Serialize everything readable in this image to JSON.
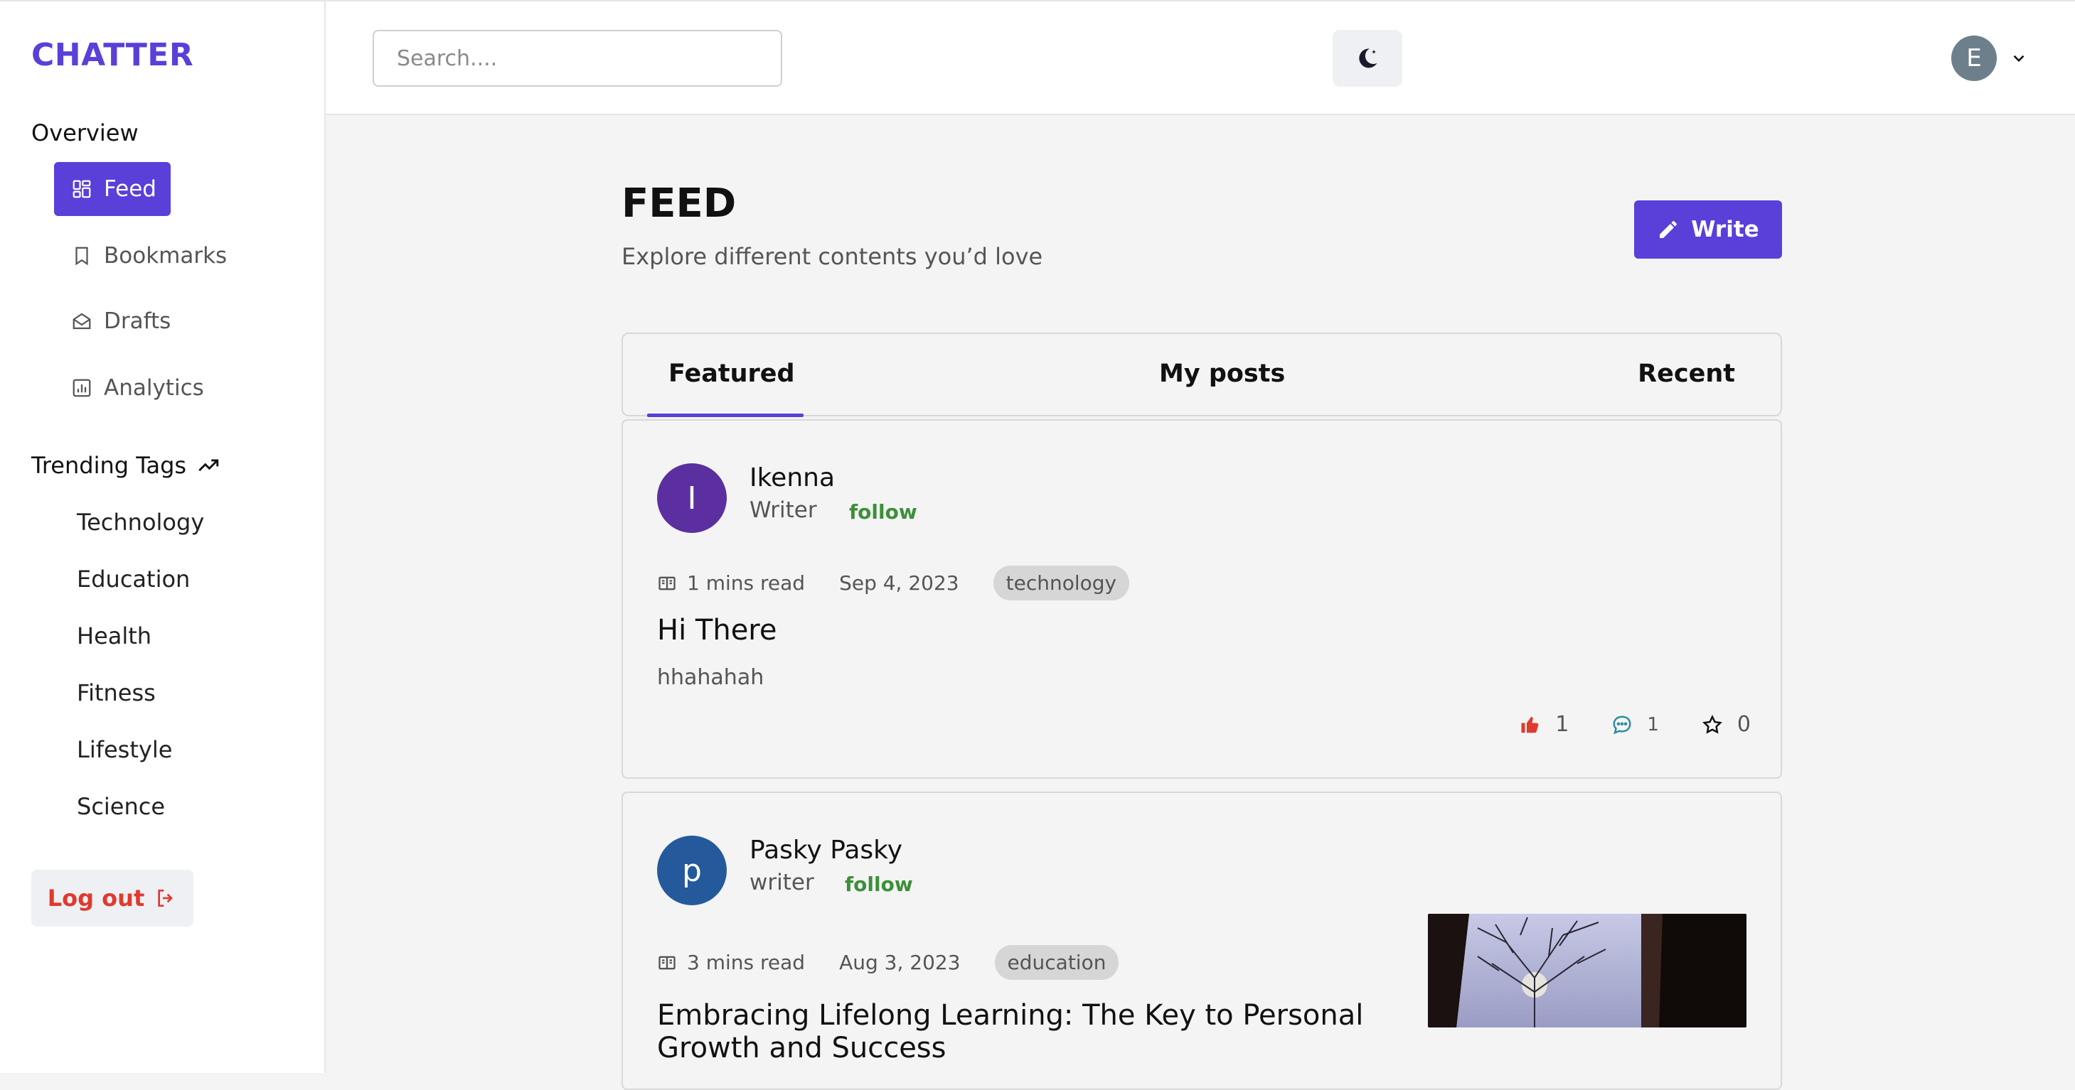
{
  "app": {
    "logo": "CHATTER"
  },
  "sidebar": {
    "overview_label": "Overview",
    "nav": [
      {
        "label": "Feed",
        "icon": "feed-icon",
        "active": true
      },
      {
        "label": "Bookmarks",
        "icon": "bookmark-icon"
      },
      {
        "label": "Drafts",
        "icon": "drafts-icon"
      },
      {
        "label": "Analytics",
        "icon": "analytics-icon"
      }
    ],
    "trending_label": "Trending Tags",
    "tags": [
      "Technology",
      "Education",
      "Health",
      "Fitness",
      "Lifestyle",
      "Science"
    ],
    "logout_label": "Log out"
  },
  "topbar": {
    "search_placeholder": "Search....",
    "user_initial": "E"
  },
  "main": {
    "title": "FEED",
    "subtitle": "Explore different contents you’d love",
    "write_label": "Write",
    "tabs": [
      {
        "label": "Featured",
        "active": true
      },
      {
        "label": "My posts"
      },
      {
        "label": "Recent"
      }
    ],
    "posts": [
      {
        "author_initial": "I",
        "author_color": "#5b2fa0",
        "author": "Ikenna",
        "role": "Writer",
        "follow_label": "follow",
        "read_time": "1 mins read",
        "date": "Sep 4, 2023",
        "tag": "technology",
        "title": "Hi There",
        "body": "hhahahah",
        "likes": "1",
        "comments": "1",
        "bookmarks": "0"
      },
      {
        "author_initial": "p",
        "author_color": "#245a9c",
        "author": "Pasky Pasky",
        "role": "writer",
        "follow_label": "follow",
        "read_time": "3 mins read",
        "date": "Aug 3, 2023",
        "tag": "education",
        "title_line1": "Embracing Lifelong Learning: The Key to Personal",
        "title_line2": "Growth and Success"
      }
    ]
  },
  "colors": {
    "accent": "#5b3fd9",
    "follow": "#3d8f3a",
    "logout": "#e03a2f",
    "like": "#e03a2f"
  }
}
